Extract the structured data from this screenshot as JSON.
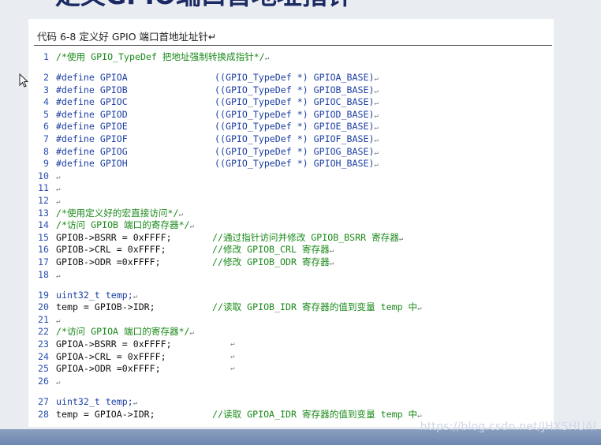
{
  "header": {
    "title": "定义GPIO端口首地址指针"
  },
  "document": {
    "caption": "代码 6-8 定义好 GPIO 端口首地址址针↵",
    "lines": [
      {
        "n": "1",
        "code": "/*使用 GPIO_TypeDef 把地址强制转换成指针*/",
        "mark": "↵",
        "kind": "comment"
      },
      {
        "n": "2",
        "code": "#define GPIOA",
        "rhs": "((GPIO_TypeDef *) GPIOA_BASE)",
        "mark": "↵",
        "kind": "define"
      },
      {
        "n": "3",
        "code": "#define GPIOB",
        "rhs": "((GPIO_TypeDef *) GPIOB_BASE)",
        "mark": "↵",
        "kind": "define"
      },
      {
        "n": "4",
        "code": "#define GPIOC",
        "rhs": "((GPIO_TypeDef *) GPIOC_BASE)",
        "mark": "↵",
        "kind": "define"
      },
      {
        "n": "5",
        "code": "#define GPIOD",
        "rhs": "((GPIO_TypeDef *) GPIOD_BASE)",
        "mark": "↵",
        "kind": "define"
      },
      {
        "n": "6",
        "code": "#define GPIOE",
        "rhs": "((GPIO_TypeDef *) GPIOE_BASE)",
        "mark": "↵",
        "kind": "define"
      },
      {
        "n": "7",
        "code": "#define GPIOF",
        "rhs": "((GPIO_TypeDef *) GPIOF_BASE)",
        "mark": "↵",
        "kind": "define"
      },
      {
        "n": "8",
        "code": "#define GPIOG",
        "rhs": "((GPIO_TypeDef *) GPIOG_BASE)",
        "mark": "↵",
        "kind": "define"
      },
      {
        "n": "9",
        "code": "#define GPIOH",
        "rhs": "((GPIO_TypeDef *) GPIOH_BASE)",
        "mark": "↵",
        "kind": "define"
      },
      {
        "n": "10",
        "code": "",
        "mark": "↵",
        "kind": "plain"
      },
      {
        "n": "11",
        "code": "",
        "mark": "↵",
        "kind": "plain"
      },
      {
        "n": "12",
        "code": "",
        "mark": "↵",
        "kind": "plain"
      },
      {
        "n": "13",
        "code": "/*使用定义好的宏直接访问*/",
        "mark": "↵",
        "kind": "comment"
      },
      {
        "n": "14",
        "code": "/*访问 GPIOB 端口的寄存器*/",
        "mark": "↵",
        "kind": "comment"
      },
      {
        "n": "15",
        "code": "GPIOB->BSRR = 0xFFFF;",
        "rhs": "//通过指针访问并修改 GPIOB_BSRR 寄存器",
        "mark": "↵",
        "kind": "stmt"
      },
      {
        "n": "16",
        "code": "GPIOB->CRL = 0xFFFF;",
        "rhs": "//修改 GPIOB_CRL 寄存器",
        "mark": "↵",
        "kind": "stmt"
      },
      {
        "n": "17",
        "code": "GPIOB->ODR =0xFFFF;",
        "rhs": "//修改 GPIOB_ODR 寄存器",
        "mark": "↵",
        "kind": "stmt"
      },
      {
        "n": "18",
        "code": "",
        "mark": "↵",
        "kind": "plain"
      },
      {
        "n": "19",
        "code": "uint32_t temp;",
        "mark": "↵",
        "kind": "type"
      },
      {
        "n": "20",
        "code": "temp = GPIOB->IDR;",
        "rhs": "//读取 GPIOB_IDR 寄存器的值到变量 temp 中",
        "mark": "↵",
        "kind": "stmt"
      },
      {
        "n": "21",
        "code": "",
        "mark": "↵",
        "kind": "plain"
      },
      {
        "n": "22",
        "code": "/*访问 GPIOA 端口的寄存器*/",
        "mark": "↵",
        "kind": "comment"
      },
      {
        "n": "23",
        "code": "GPIOA->BSRR = 0xFFFF;",
        "mark": "↵",
        "kind": "stmt2"
      },
      {
        "n": "24",
        "code": "GPIOA->CRL = 0xFFFF;",
        "mark": "↵",
        "kind": "stmt2"
      },
      {
        "n": "25",
        "code": "GPIOA->ODR =0xFFFF;",
        "mark": "↵",
        "kind": "stmt2"
      },
      {
        "n": "26",
        "code": "",
        "mark": "↵",
        "kind": "plain"
      },
      {
        "n": "27",
        "code": "uint32_t temp;",
        "mark": "↵",
        "kind": "type"
      },
      {
        "n": "28",
        "code": "temp = GPIOA->IDR;",
        "rhs": "//读取 GPIOA_IDR 寄存器的值到变量 temp 中",
        "mark": "↵",
        "kind": "stmt"
      }
    ]
  },
  "watermark": "https://blog.csdn.net/JHXSHUAI",
  "colors": {
    "line_number": "#2a4fb0",
    "comment": "#1a8a1a",
    "keyword": "#1d3fa3",
    "text": "#111111"
  }
}
